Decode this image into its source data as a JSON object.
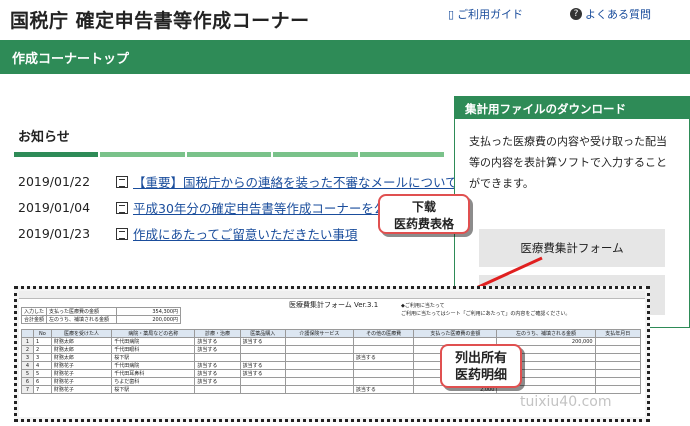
{
  "header": {
    "site_title": "国税庁 確定申告書等作成コーナー",
    "guide_link": "ご利用ガイド",
    "faq_link": "よくある質問"
  },
  "nav": {
    "title": "作成コーナートップ"
  },
  "news": {
    "title": "お知らせ",
    "items": [
      {
        "date": "2019/01/22",
        "text": "【重要】国税庁からの連絡を装った不審なメールについて"
      },
      {
        "date": "2019/01/04",
        "text": "平成30年分の確定申告書等作成コーナーを公開"
      },
      {
        "date": "2019/01/23",
        "text": "作成にあたってご留意いただきたい事項"
      }
    ]
  },
  "download": {
    "title": "集計用ファイルのダウンロード",
    "description": "支払った医療費の内容や受け取った配当等の内容を表計算ソフトで入力することができます。",
    "button_label": "医療費集計フォーム"
  },
  "callouts": {
    "download_note_line1": "下载",
    "download_note_line2": "医药费表格",
    "list_note_line1": "列出所有",
    "list_note_line2": "医药明细"
  },
  "sheet": {
    "title": "医療費集計フォーム Ver.3.1",
    "note1": "◆ご利用に当たって",
    "note2": "ご利用に当たってはシート「ご利用にあたって」の内容をご確認ください。",
    "summary": [
      {
        "label": "支払った医療費の金額",
        "value": "354,300円"
      },
      {
        "label": "左のうち、補填される金額",
        "value": "200,000円"
      }
    ],
    "summary_side": [
      "入力した",
      "合計金額"
    ],
    "columns": [
      "No",
      "医療を受けた人",
      "病院・薬局などの名称",
      "診療・治療",
      "医薬品購入",
      "介護保険サービス",
      "その他の医療費",
      "支払った医療費の金額",
      "左のうち、補填される金額",
      "支払年月日"
    ],
    "rows": [
      {
        "no": "1",
        "person": "財務太郎",
        "hospital": "千代田病院",
        "c1": "該当する",
        "c2": "該当する",
        "c3": "",
        "c4": "",
        "amount": "",
        "cover": "200,000",
        "date": ""
      },
      {
        "no": "2",
        "person": "財務太郎",
        "hospital": "千代田眼科",
        "c1": "該当する",
        "c2": "",
        "c3": "",
        "c4": "",
        "amount": "",
        "cover": "",
        "date": ""
      },
      {
        "no": "3",
        "person": "財務太郎",
        "hospital": "桜下駅",
        "c1": "",
        "c2": "",
        "c3": "",
        "c4": "該当する",
        "amount": "",
        "cover": "",
        "date": ""
      },
      {
        "no": "4",
        "person": "財務花子",
        "hospital": "千代田病院",
        "c1": "該当する",
        "c2": "該当する",
        "c3": "",
        "c4": "",
        "amount": "",
        "cover": "",
        "date": ""
      },
      {
        "no": "5",
        "person": "財務花子",
        "hospital": "千代田耳鼻科",
        "c1": "該当する",
        "c2": "該当する",
        "c3": "",
        "c4": "",
        "amount": "",
        "cover": "",
        "date": ""
      },
      {
        "no": "6",
        "person": "財務花子",
        "hospital": "ちよだ歯科",
        "c1": "該当する",
        "c2": "",
        "c3": "",
        "c4": "",
        "amount": "100,000",
        "cover": "",
        "date": ""
      },
      {
        "no": "7",
        "person": "財務花子",
        "hospital": "桜下駅",
        "c1": "",
        "c2": "",
        "c3": "",
        "c4": "該当する",
        "amount": "2,000",
        "cover": "",
        "date": ""
      }
    ]
  },
  "watermark": "tuixiu40.com",
  "colors": {
    "green": "#2e8b57",
    "link": "#1a4d9c",
    "callout_border": "#e05050",
    "arrow": "#e02020"
  }
}
